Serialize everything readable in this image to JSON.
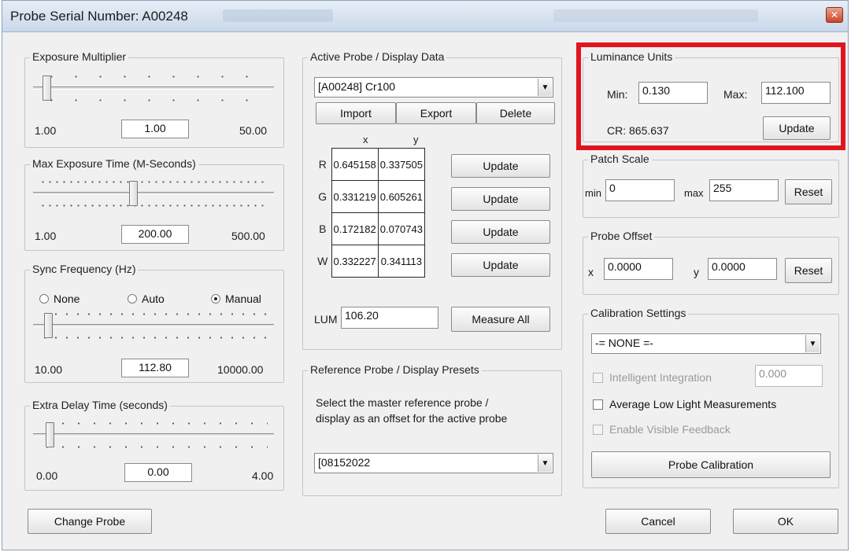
{
  "window": {
    "title": "Probe Serial Number: A00248",
    "close_icon": "close-icon"
  },
  "exposure_multiplier": {
    "title": "Exposure Multiplier",
    "min": "1.00",
    "value": "1.00",
    "max": "50.00",
    "level_fraction": 0.0
  },
  "max_exposure": {
    "title": "Max Exposure Time (M-Seconds)",
    "min": "1.00",
    "value": "200.00",
    "max": "500.00",
    "level_fraction": 0.4
  },
  "sync_frequency": {
    "title": "Sync Frequency (Hz)",
    "options": [
      {
        "label": "None",
        "selected": false
      },
      {
        "label": "Auto",
        "selected": false
      },
      {
        "label": "Manual",
        "selected": true
      }
    ],
    "min": "10.00",
    "value": "112.80",
    "max": "10000.00",
    "level_fraction": 0.01
  },
  "extra_delay": {
    "title": "Extra Delay Time (seconds)",
    "min": "0.00",
    "value": "0.00",
    "max": "4.00",
    "level_fraction": 0.0
  },
  "change_probe_label": "Change Probe",
  "active_probe": {
    "title": "Active Probe / Display Data",
    "selected": "[A00248] Cr100",
    "import_label": "Import",
    "export_label": "Export",
    "delete_label": "Delete",
    "col_x": "x",
    "col_y": "y",
    "rows": [
      {
        "label": "R",
        "x": "0.645158",
        "y": "0.337505",
        "update": "Update"
      },
      {
        "label": "G",
        "x": "0.331219",
        "y": "0.605261",
        "update": "Update"
      },
      {
        "label": "B",
        "x": "0.172182",
        "y": "0.070743",
        "update": "Update"
      },
      {
        "label": "W",
        "x": "0.332227",
        "y": "0.341113",
        "update": "Update"
      }
    ],
    "lum_label": "LUM",
    "lum_value": "106.20",
    "measure_all_label": "Measure All"
  },
  "reference_probe": {
    "title": "Reference Probe / Display Presets",
    "description_line1": "Select the master reference probe /",
    "description_line2": "display as an offset for the active probe",
    "selected": "[08152022"
  },
  "luminance_units": {
    "title": "Luminance Units",
    "min_label": "Min:",
    "min_value": "0.130",
    "max_label": "Max:",
    "max_value": "112.100",
    "cr_text": "CR: 865.637",
    "update_label": "Update",
    "highlight_color": "#e0151f"
  },
  "patch_scale": {
    "title": "Patch Scale",
    "min_label": "min",
    "min_value": "0",
    "max_label": "max",
    "max_value": "255",
    "reset_label": "Reset"
  },
  "probe_offset": {
    "title": "Probe Offset",
    "x_label": "x",
    "x_value": "0.0000",
    "y_label": "y",
    "y_value": "0.0000",
    "reset_label": "Reset"
  },
  "calibration": {
    "title": "Calibration Settings",
    "selected": "-= NONE =-",
    "intelligent_label": "Intelligent Integration",
    "intelligent_value": "0.000",
    "average_low_label": "Average Low Light Measurements",
    "visible_feedback_label": "Enable Visible Feedback",
    "probe_calibration_label": "Probe Calibration"
  },
  "footer": {
    "cancel_label": "Cancel",
    "ok_label": "OK"
  }
}
